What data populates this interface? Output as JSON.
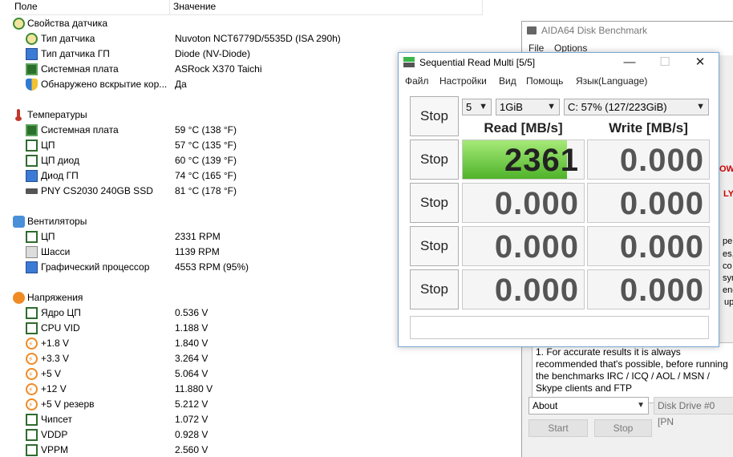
{
  "sensor_list": {
    "headers": {
      "field": "Поле",
      "value": "Значение"
    },
    "groups": [
      {
        "title": "Свойства датчика",
        "icon": "sensor-props-icon",
        "items": [
          {
            "label": "Тип датчика",
            "value": "Nuvoton NCT6779D/5535D  (ISA 290h)",
            "icon": "gauge-icon"
          },
          {
            "label": "Тип датчика ГП",
            "value": "Diode  (NV-Diode)",
            "icon": "gpu-icon"
          },
          {
            "label": "Системная плата",
            "value": "ASRock X370 Taichi",
            "icon": "motherboard-icon"
          },
          {
            "label": "Обнаружено вскрытие кор...",
            "value": "Да",
            "icon": "shield-icon"
          }
        ]
      },
      {
        "title": "Температуры",
        "icon": "thermometer-icon",
        "items": [
          {
            "label": "Системная плата",
            "value": "59 °C  (138 °F)",
            "icon": "motherboard-icon"
          },
          {
            "label": "ЦП",
            "value": "57 °C  (135 °F)",
            "icon": "cpu-icon"
          },
          {
            "label": "ЦП диод",
            "value": "60 °C  (139 °F)",
            "icon": "cpu-icon"
          },
          {
            "label": "Диод ГП",
            "value": "74 °C  (165 °F)",
            "icon": "gpu-icon"
          },
          {
            "label": "PNY CS2030 240GB SSD",
            "value": "81 °C  (178 °F)",
            "icon": "ssd-icon"
          }
        ]
      },
      {
        "title": "Вентиляторы",
        "icon": "fan-icon",
        "items": [
          {
            "label": "ЦП",
            "value": "2331 RPM",
            "icon": "cpu-icon"
          },
          {
            "label": "Шасси",
            "value": "1139 RPM",
            "icon": "case-icon"
          },
          {
            "label": "Графический процессор",
            "value": "4553 RPM  (95%)",
            "icon": "gpu-icon"
          }
        ]
      },
      {
        "title": "Напряжения",
        "icon": "voltage-icon",
        "items": [
          {
            "label": "Ядро ЦП",
            "value": "0.536 V",
            "icon": "cpu-icon"
          },
          {
            "label": "CPU VID",
            "value": "1.188 V",
            "icon": "cpu-icon"
          },
          {
            "label": "+1.8 V",
            "value": "1.840 V",
            "icon": "voltage-rail-icon"
          },
          {
            "label": "+3.3 V",
            "value": "3.264 V",
            "icon": "voltage-rail-icon"
          },
          {
            "label": "+5 V",
            "value": "5.064 V",
            "icon": "voltage-rail-icon"
          },
          {
            "label": "+12 V",
            "value": "11.880 V",
            "icon": "voltage-rail-icon"
          },
          {
            "label": "+5 V резерв",
            "value": "5.212 V",
            "icon": "voltage-rail-icon"
          },
          {
            "label": "Чипсет",
            "value": "1.072 V",
            "icon": "chip-icon"
          },
          {
            "label": "VDDP",
            "value": "0.928 V",
            "icon": "chip-icon"
          },
          {
            "label": "VPPM",
            "value": "2.560 V",
            "icon": "chip-icon"
          }
        ]
      }
    ]
  },
  "disk_benchmark": {
    "title": "AIDA64 Disk Benchmark",
    "menu": [
      "File",
      "Options"
    ],
    "partial_lines": [
      "OW",
      "LY",
      "pe",
      "es,",
      "co",
      "syn",
      "enc",
      "up"
    ],
    "notes": "1. For accurate results it is always recommended that's possible, before running the benchmarks IRC / ICQ / AOL / MSN / Skype clients and FTP",
    "test_select": "About",
    "drive_select": "Disk Drive #0  [PN",
    "start_label": "Start",
    "stop_label": "Stop"
  },
  "seq_window": {
    "title": "Sequential Read Multi [5/5]",
    "controls": {
      "minimize": "—",
      "maximize": "☐",
      "close": "✕"
    },
    "menu": [
      "Файл",
      "Настройки",
      "Вид",
      "Помощь",
      "Язык(Language)"
    ],
    "count_select": "5",
    "size_select": "1GiB",
    "drive_select": "C: 57% (127/223GiB)",
    "read_header": "Read [MB/s]",
    "write_header": "Write [MB/s]",
    "stop_label": "Stop",
    "rows": [
      {
        "read": "2361",
        "write": "0.000",
        "read_progress": 0.86
      },
      {
        "read": "0.000",
        "write": "0.000",
        "read_progress": 0
      },
      {
        "read": "0.000",
        "write": "0.000",
        "read_progress": 0
      },
      {
        "read": "0.000",
        "write": "0.000",
        "read_progress": 0
      }
    ],
    "status_text": ""
  }
}
